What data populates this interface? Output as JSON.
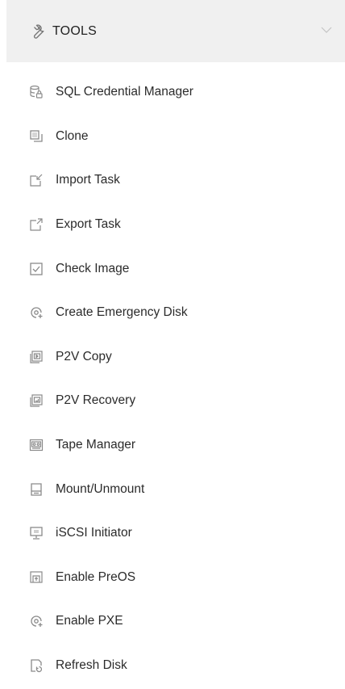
{
  "header": {
    "icon": "wrench-icon",
    "title": "TOOLS",
    "chevron_icon": "chevron-down-icon"
  },
  "colors": {
    "header_bg": "#f0f0f0",
    "icon_gray": "#8a8a8a",
    "text": "#2b2b2b"
  },
  "menu": {
    "items": [
      {
        "label": "SQL Credential Manager",
        "icon": "database-lock-icon"
      },
      {
        "label": "Clone",
        "icon": "clone-icon"
      },
      {
        "label": "Import Task",
        "icon": "import-icon"
      },
      {
        "label": "Export Task",
        "icon": "export-icon"
      },
      {
        "label": "Check Image",
        "icon": "checkbox-icon"
      },
      {
        "label": "Create Emergency Disk",
        "icon": "disk-plus-icon"
      },
      {
        "label": "P2V Copy",
        "icon": "p2v-copy-icon"
      },
      {
        "label": "P2V Recovery",
        "icon": "p2v-recovery-icon"
      },
      {
        "label": "Tape Manager",
        "icon": "tape-icon"
      },
      {
        "label": "Mount/Unmount",
        "icon": "mount-icon"
      },
      {
        "label": "iSCSI Initiator",
        "icon": "monitor-icon"
      },
      {
        "label": "Enable PreOS",
        "icon": "preos-icon"
      },
      {
        "label": "Enable PXE",
        "icon": "disk-plus-icon"
      },
      {
        "label": "Refresh Disk",
        "icon": "refresh-disk-icon"
      }
    ]
  }
}
